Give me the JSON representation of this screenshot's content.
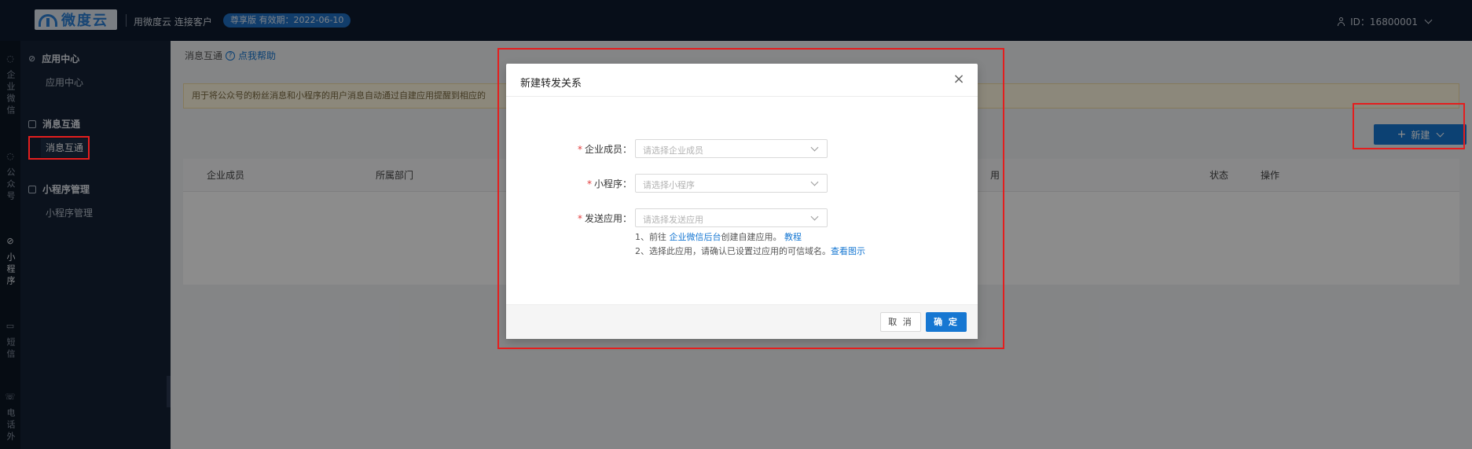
{
  "header": {
    "logo_text": "微度云",
    "slogan": "用微度云 连接客户",
    "badge": "尊享版 有效期：2022-06-10",
    "user_id": "ID：16800001"
  },
  "rail": {
    "items": [
      {
        "label": "企业微信"
      },
      {
        "label": "公众号"
      },
      {
        "label": "小程序"
      },
      {
        "label": "短信"
      },
      {
        "label": "电话外"
      }
    ]
  },
  "sidebar": {
    "groups": [
      {
        "title": "应用中心",
        "items": [
          "应用中心"
        ]
      },
      {
        "title": "消息互通",
        "items": [
          "消息互通"
        ]
      },
      {
        "title": "小程序管理",
        "items": [
          "小程序管理"
        ]
      }
    ]
  },
  "main": {
    "breadcrumb": "消息互通",
    "help_link": "点我帮助",
    "notice": "用于将公众号的粉丝消息和小程序的用户消息自动通过自建应用提醒到相应的",
    "new_button": "新建",
    "table": {
      "columns": [
        "企业成员",
        "所属部门",
        "用",
        "状态",
        "操作"
      ]
    }
  },
  "modal": {
    "title": "新建转发关系",
    "fields": [
      {
        "label": "企业成员：",
        "placeholder": "请选择企业成员"
      },
      {
        "label": "小程序：",
        "placeholder": "请选择小程序"
      },
      {
        "label": "发送应用：",
        "placeholder": "请选择发送应用"
      }
    ],
    "hint1": {
      "prefix": "1、前往 ",
      "link1": "企业微信后台",
      "middle": "创建自建应用。 ",
      "link2": "教程"
    },
    "hint2": {
      "prefix": "2、选择此应用，请确认已设置过应用的可信域名。",
      "link": "查看图示"
    },
    "cancel": "取 消",
    "ok": "确 定"
  },
  "colors": {
    "accent": "#1677d2",
    "annotation": "#e41e1e",
    "header_bg": "#0d1b2e",
    "sidebar_bg": "#152235"
  }
}
